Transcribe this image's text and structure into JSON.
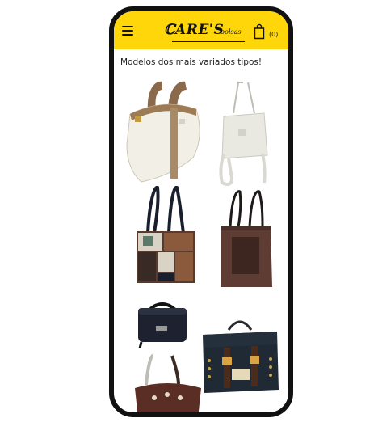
{
  "header": {
    "logo_main": "ℂARE'S",
    "logo_sub": "bolsas",
    "cart_count": "(0)",
    "background": "#ffd60a"
  },
  "main": {
    "headline": "Modelos dos mais variados tipos!"
  },
  "products": [
    {
      "icon": "white-leather-boston-bag"
    },
    {
      "icon": "white-bucket-bag"
    },
    {
      "icon": "patchwork-tote-bag"
    },
    {
      "icon": "brown-tote-bag"
    },
    {
      "icon": "black-vanity-case"
    },
    {
      "icon": "black-studded-satchel"
    },
    {
      "icon": "brown-bucket-bag"
    }
  ]
}
